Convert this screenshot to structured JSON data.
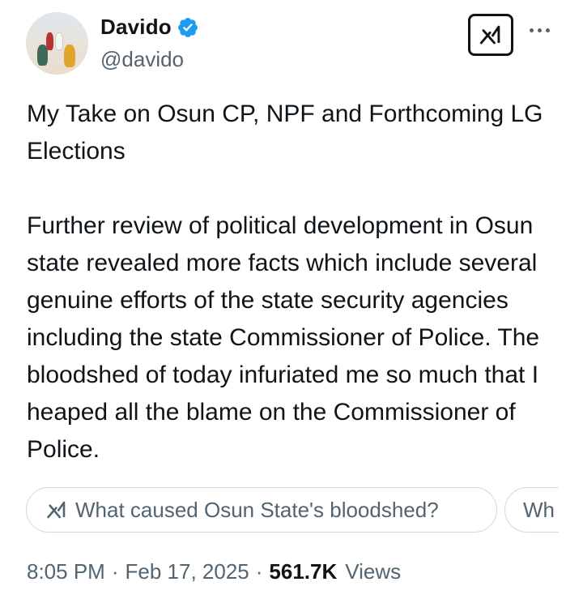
{
  "author": {
    "name": "Davido",
    "handle": "@davido",
    "verified_color": "#1d9bf0"
  },
  "tweet": {
    "text": "My Take on Osun CP, NPF and Forthcoming LG Elections\n\nFurther review of political development in Osun state revealed more facts which include several genuine efforts of the state security agencies including the state Commissioner of Police. The bloodshed of today infuriated me so much that I heaped all the blame on the Commissioner of Police."
  },
  "grok_suggestions": [
    "What caused Osun State's bloodshed?",
    "Wh"
  ],
  "meta": {
    "time": "8:05 PM",
    "separator": "·",
    "date": "Feb 17, 2025",
    "views_count": "561.7K",
    "views_label": "Views"
  },
  "icons": {
    "verified": "verified-badge-icon",
    "grok": "grok-icon",
    "more": "more-options-icon"
  }
}
